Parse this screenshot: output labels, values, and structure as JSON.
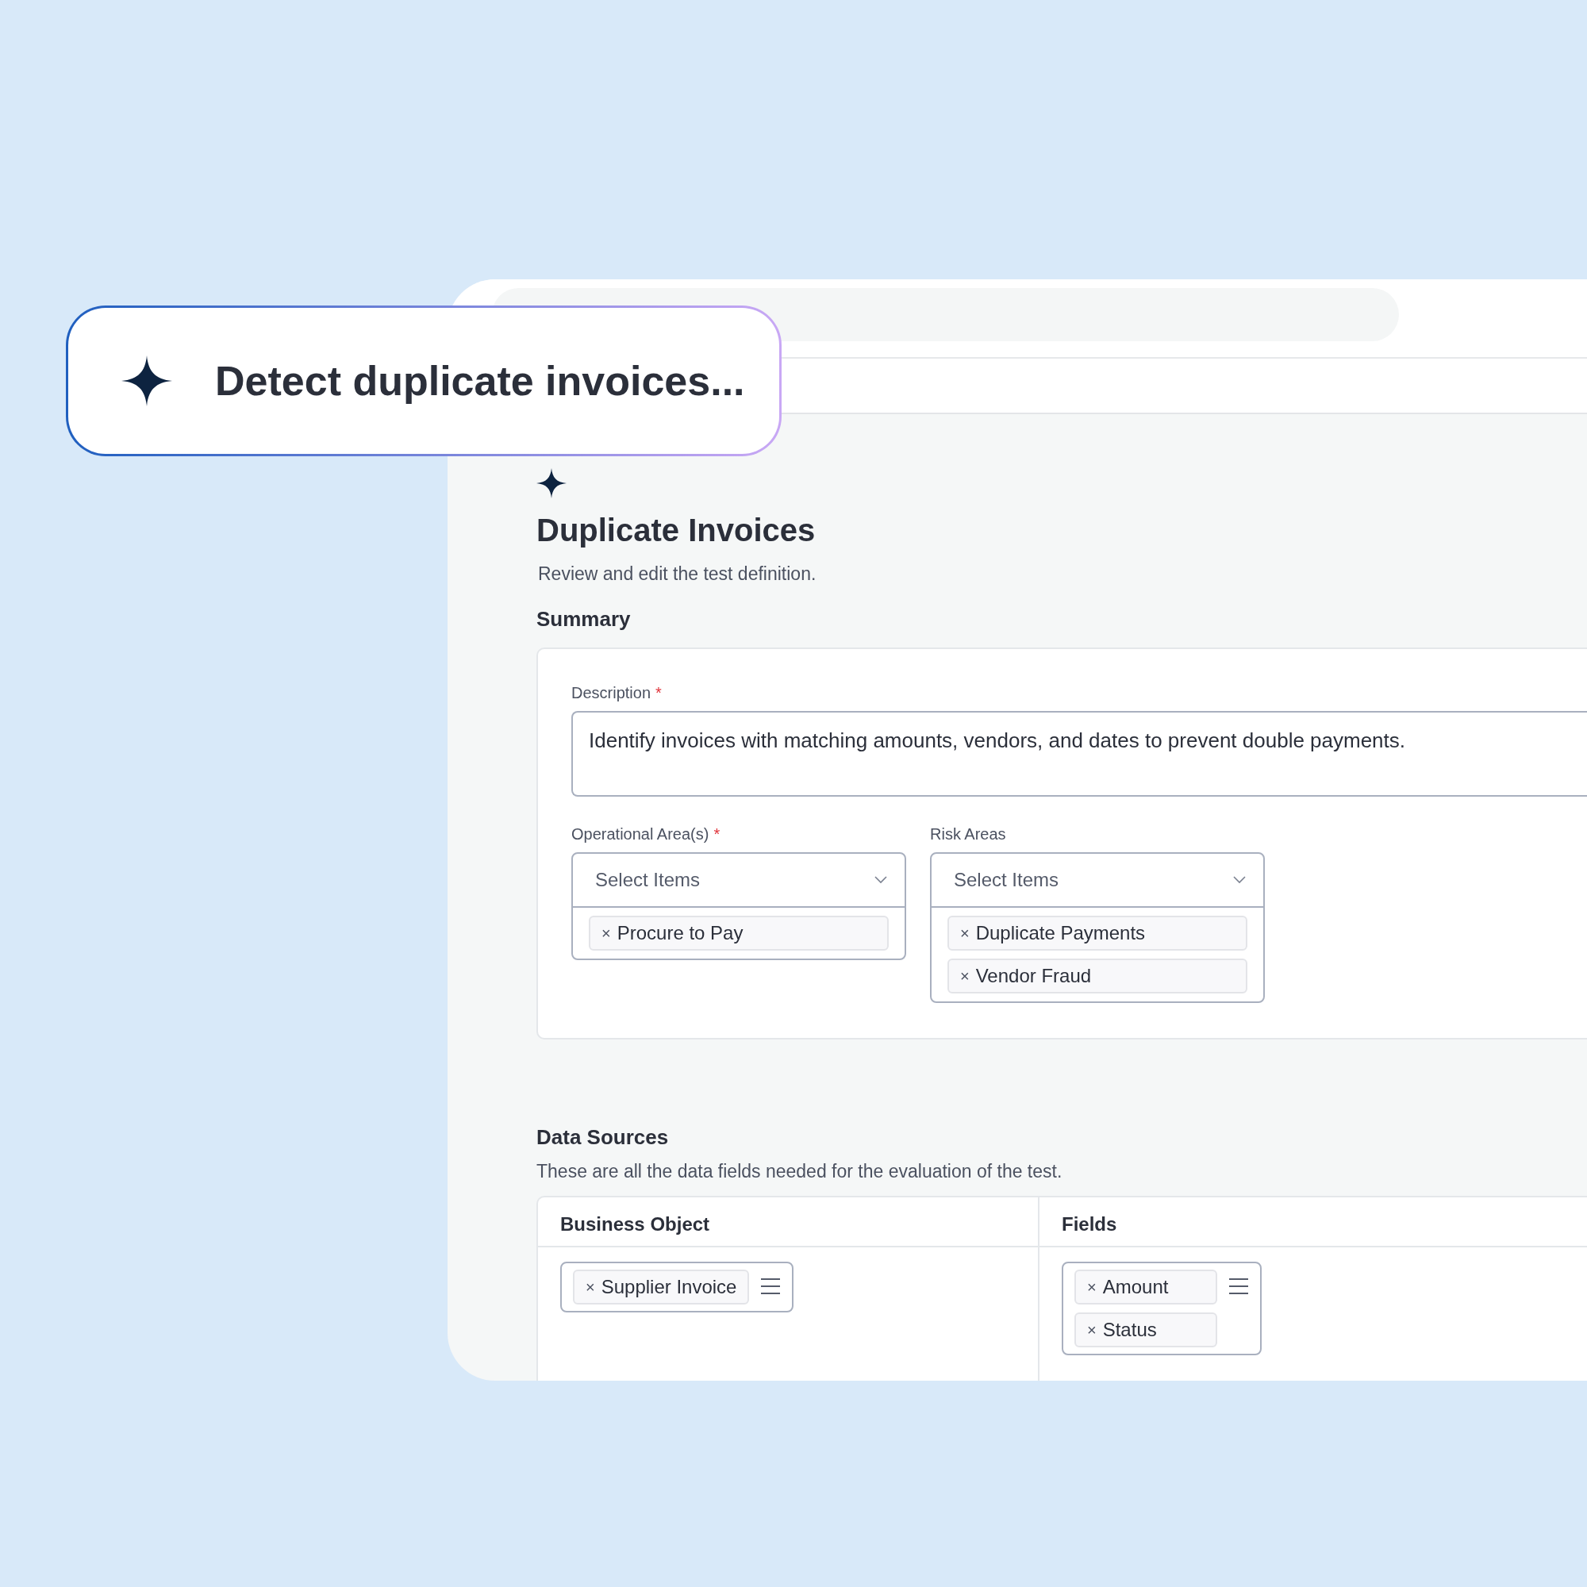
{
  "prompt": {
    "text": "Detect duplicate invoices..."
  },
  "page": {
    "title": "Duplicate Invoices",
    "subtitle": "Review and edit the test definition."
  },
  "summary": {
    "heading": "Summary",
    "description": {
      "label": "Description",
      "required_mark": "*",
      "value": "Identify invoices with matching amounts, vendors, and dates to prevent double payments."
    },
    "selects": [
      {
        "label": "Operational Area(s)",
        "required_mark": "*",
        "placeholder": "Select Items",
        "chips": [
          {
            "remove": "×",
            "label": "Procure to Pay"
          }
        ]
      },
      {
        "label": "Risk Areas",
        "placeholder": "Select Items",
        "chips": [
          {
            "remove": "×",
            "label": "Duplicate Payments"
          },
          {
            "remove": "×",
            "label": "Vendor Fraud"
          }
        ]
      }
    ]
  },
  "data_sources": {
    "heading": "Data Sources",
    "description": "These are all the data fields needed for the evaluation of the test.",
    "columns": [
      "Business Object",
      "Fields"
    ],
    "business_objects": [
      {
        "remove": "×",
        "label": "Supplier Invoice"
      }
    ],
    "fields": [
      {
        "remove": "×",
        "label": "Amount"
      },
      {
        "remove": "×",
        "label": "Status"
      }
    ]
  }
}
